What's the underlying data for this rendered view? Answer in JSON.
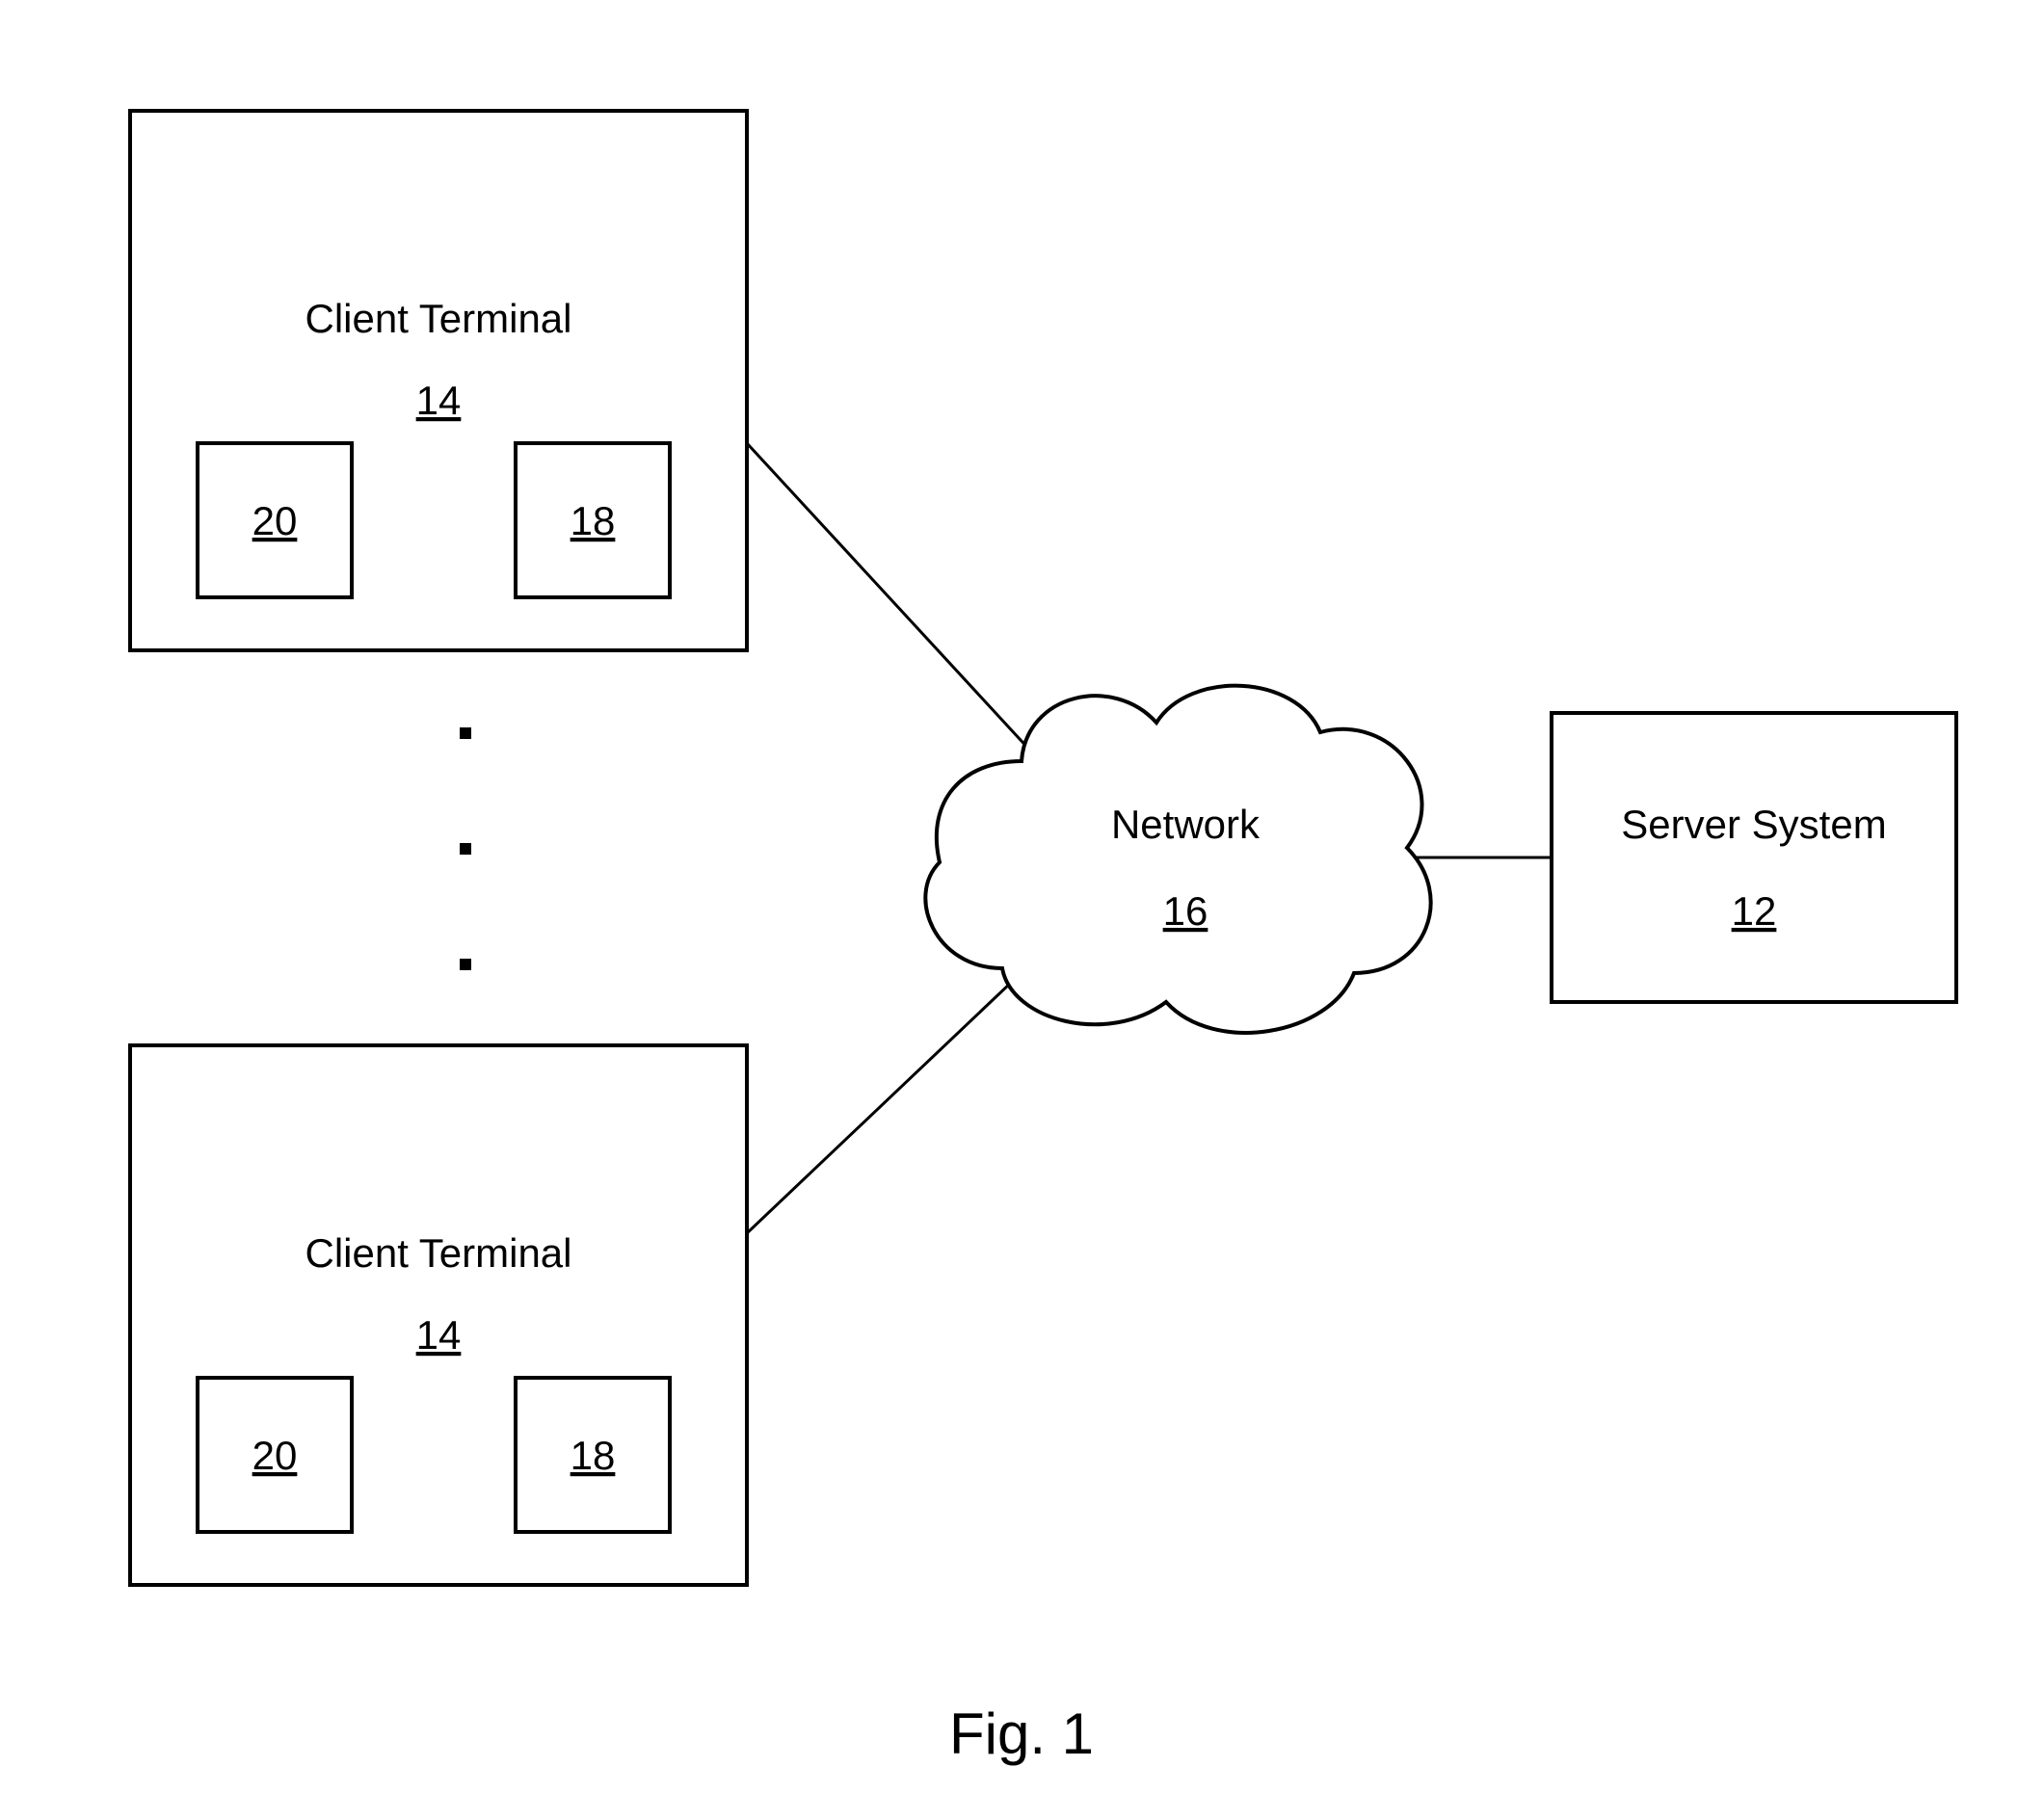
{
  "client1": {
    "title": "Client Terminal",
    "ref": "14",
    "box_left": "20",
    "box_right": "18"
  },
  "client2": {
    "title": "Client Terminal",
    "ref": "14",
    "box_left": "20",
    "box_right": "18"
  },
  "network": {
    "title": "Network",
    "ref": "16"
  },
  "server": {
    "title": "Server System",
    "ref": "12"
  },
  "caption": "Fig. 1"
}
